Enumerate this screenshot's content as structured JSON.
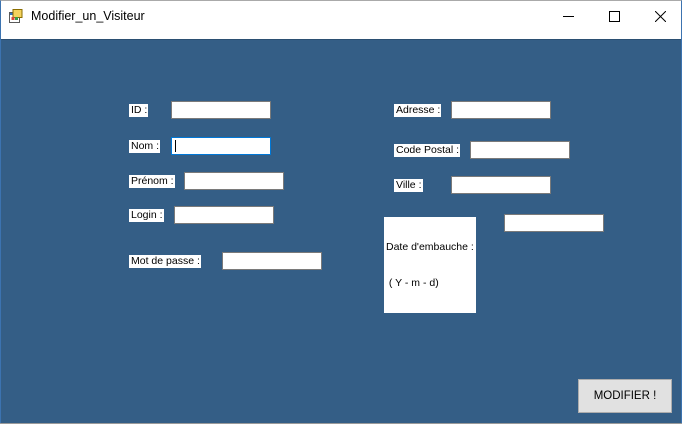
{
  "window": {
    "title": "Modifier_un_Visiteur",
    "controls": {
      "minimize": "minimize-icon",
      "maximize": "maximize-icon",
      "close": "close-icon"
    }
  },
  "form": {
    "left": {
      "id_label": "ID :",
      "nom_label": "Nom :",
      "prenom_label": "Prénom :",
      "login_label": "Login :",
      "mdp_label": "Mot de passe :"
    },
    "right": {
      "adresse_label": "Adresse :",
      "cp_label": "Code Postal :",
      "ville_label": "Ville :",
      "date_label_line1": "Date d'embauche :",
      "date_label_line2": " ( Y - m - d)"
    },
    "fields": {
      "id": "",
      "nom": "",
      "prenom": "",
      "login": "",
      "mdp": "",
      "adresse": "",
      "cp": "",
      "ville": "",
      "date": ""
    },
    "submit_label": "MODIFIER !"
  },
  "colors": {
    "client_background": "#345e86",
    "button_background": "#e1e1e1",
    "focus_border": "#0078d7"
  }
}
